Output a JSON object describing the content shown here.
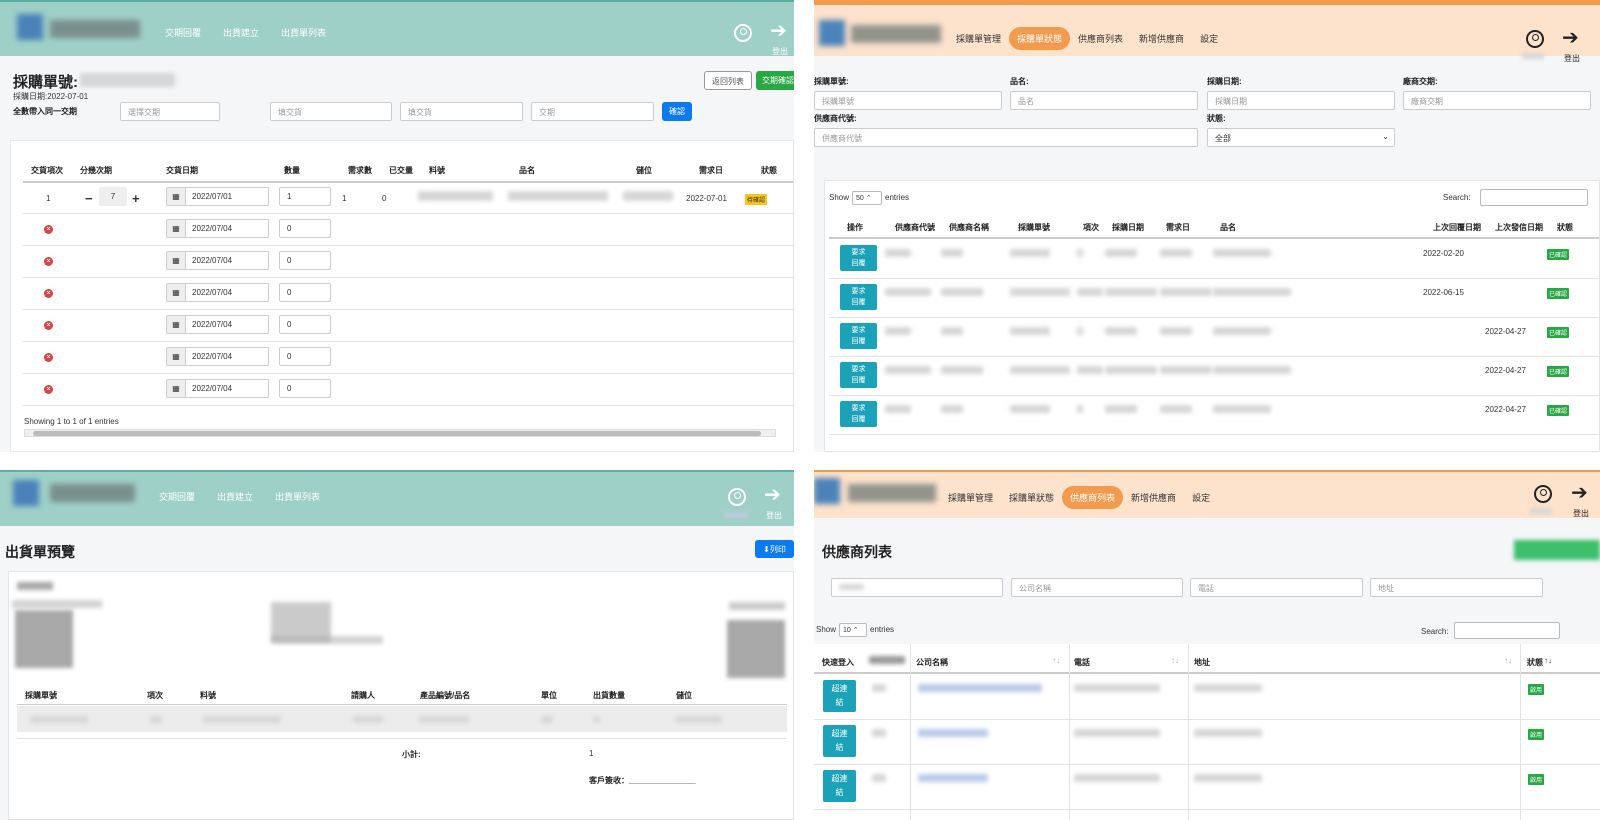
{
  "p1": {
    "nav": [
      "交期回覆",
      "出貨建立",
      "出貨單列表"
    ],
    "logout_label": "登出",
    "title": "採購單號:",
    "purchase_date": "採購日期:2022-07-01",
    "back_button": "返回列表",
    "confirm_delivery_button": "交期確認",
    "bring_same_label": "全數帶入同一交期",
    "input_placeholders": [
      "選擇交期",
      "填交貨",
      "填交貨",
      "交期"
    ],
    "confirm_button": "確認",
    "columns": [
      "交貨項次",
      "分幾次期",
      "交貨日期",
      "數量",
      "需求數",
      "已交量",
      "料號",
      "品名",
      "儲位",
      "需求日",
      "狀態"
    ],
    "first_row": {
      "item": "1",
      "split": "7",
      "date": "2022/07/01",
      "qty": "1",
      "demand": "1",
      "delivered": "0",
      "need_date": "2022-07-01",
      "status": "待確認"
    },
    "sub_rows": [
      {
        "date": "2022/07/04",
        "qty": "0"
      },
      {
        "date": "2022/07/04",
        "qty": "0"
      },
      {
        "date": "2022/07/04",
        "qty": "0"
      },
      {
        "date": "2022/07/04",
        "qty": "0"
      },
      {
        "date": "2022/07/04",
        "qty": "0"
      },
      {
        "date": "2022/07/04",
        "qty": "0"
      }
    ],
    "footer": "Showing 1 to 1 of 1 entries"
  },
  "p2": {
    "nav": [
      "採購單管理",
      "採購單狀態",
      "供應商列表",
      "新增供應商",
      "設定"
    ],
    "active_nav": 1,
    "logout_label": "登出",
    "filters": [
      {
        "label": "採購單號:",
        "placeholder": "採購單號"
      },
      {
        "label": "品名:",
        "placeholder": "品名"
      },
      {
        "label": "採購日期:",
        "placeholder": "採購日期"
      },
      {
        "label": "廠商交期:",
        "placeholder": "廠商交期"
      },
      {
        "label": "供應商代號:",
        "placeholder": "供應商代號"
      },
      {
        "label": "狀態:",
        "placeholder": "全部"
      }
    ],
    "show_label": "Show",
    "show_value": "50",
    "entries_label": "entries",
    "search_label": "Search:",
    "columns": [
      "操作",
      "供應商代號",
      "供應商名稱",
      "採購單號",
      "項次",
      "採購日期",
      "需求日",
      "品名",
      "上次回覆日期",
      "上次發信日期",
      "狀態"
    ],
    "row_button": "要求回覆",
    "rows": [
      {
        "reply": "2022-02-20",
        "sent": "",
        "status": "已確認"
      },
      {
        "reply": "2022-06-15",
        "sent": "",
        "status": "已確認"
      },
      {
        "reply": "",
        "sent": "2022-04-27",
        "status": "已確認"
      },
      {
        "reply": "",
        "sent": "2022-04-27",
        "status": "已確認"
      },
      {
        "reply": "",
        "sent": "2022-04-27",
        "status": "已確認"
      }
    ]
  },
  "p3": {
    "nav": [
      "交期回覆",
      "出貨建立",
      "出貨單列表"
    ],
    "logout_label": "登出",
    "title": "出貨單預覽",
    "print_button": "列印",
    "columns": [
      "採購單號",
      "項次",
      "料號",
      "請購人",
      "產品編號/品名",
      "單位",
      "出貨數量",
      "儲位"
    ],
    "subtotal_label": "小計:",
    "subtotal_value": "1",
    "signature_label": "客戶簽收：_______________"
  },
  "p4": {
    "nav": [
      "採購單管理",
      "採購單狀態",
      "供應商列表",
      "新增供應商",
      "設定"
    ],
    "active_nav": 2,
    "logout_label": "登出",
    "title": "供應商列表",
    "filter_placeholders": [
      "公司名稱",
      "電話",
      "地址"
    ],
    "show_label": "Show",
    "show_value": "10",
    "entries_label": "entries",
    "search_label": "Search:",
    "columns": [
      "快速登入",
      "公司名稱",
      "電話",
      "地址",
      "狀態"
    ],
    "row_button": "超連結",
    "rows": [
      {
        "status": "啟用"
      },
      {
        "status": "啟用"
      },
      {
        "status": "啟用"
      }
    ]
  }
}
